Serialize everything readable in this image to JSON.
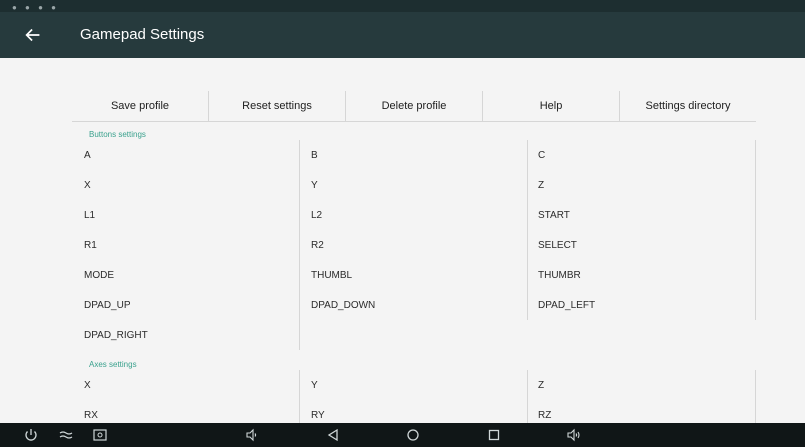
{
  "app_bar": {
    "title": "Gamepad Settings",
    "back_icon": "arrow-left-icon"
  },
  "toolbar": {
    "buttons": [
      "Save profile",
      "Reset settings",
      "Delete profile",
      "Help",
      "Settings directory"
    ]
  },
  "buttons_section": {
    "label": "Buttons settings",
    "rows": [
      [
        "A",
        "B",
        "C"
      ],
      [
        "X",
        "Y",
        "Z"
      ],
      [
        "L1",
        "L2",
        "START"
      ],
      [
        "R1",
        "R2",
        "SELECT"
      ],
      [
        "MODE",
        "THUMBL",
        "THUMBR"
      ],
      [
        "DPAD_UP",
        "DPAD_DOWN",
        "DPAD_LEFT"
      ],
      [
        "DPAD_RIGHT",
        "",
        ""
      ]
    ]
  },
  "axes_section": {
    "label": "Axes settings",
    "rows": [
      [
        "X",
        "Y",
        "Z"
      ],
      [
        "RX",
        "RY",
        "RZ"
      ]
    ]
  },
  "nav_bar": {
    "items": [
      "power-icon",
      "menu-icon",
      "screenshot-icon",
      "volume-down-icon",
      "back-triangle-icon",
      "home-circle-icon",
      "recents-square-icon",
      "volume-up-icon"
    ]
  },
  "colors": {
    "app_bar": "#263a3d",
    "status_bar": "#1d2e30",
    "nav_bar": "#101617",
    "section_label": "#3aa18d",
    "background": "#f4f4f4"
  }
}
